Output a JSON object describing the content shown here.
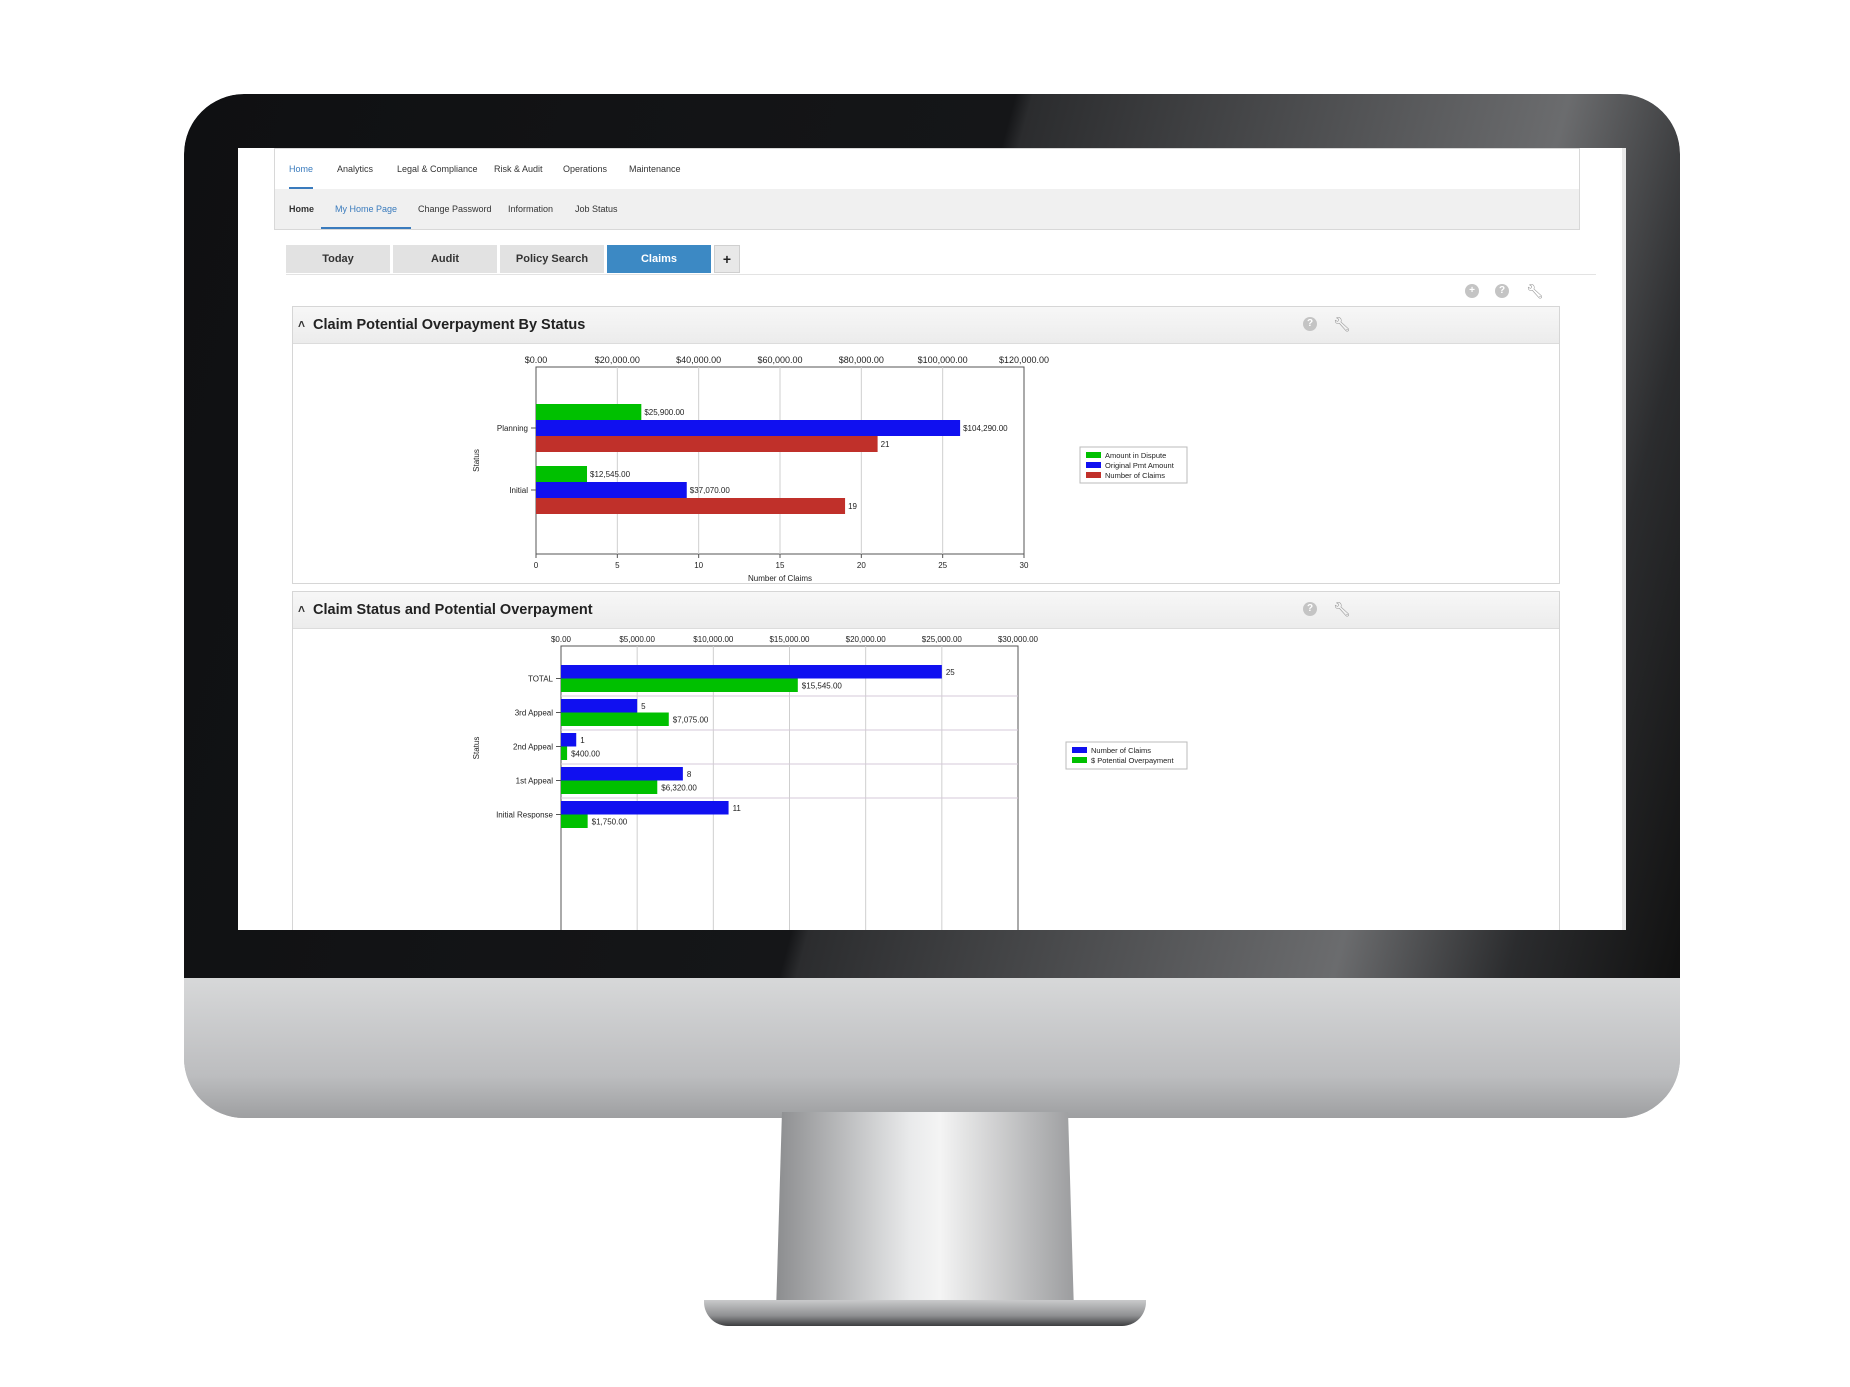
{
  "nav": {
    "top_items": [
      "Home",
      "Analytics",
      "Legal & Compliance",
      "Risk & Audit",
      "Operations",
      "Maintenance"
    ],
    "top_active": 0,
    "sub_items": [
      "Home",
      "My Home Page",
      "Change Password",
      "Information",
      "Job Status"
    ],
    "sub_active": 1
  },
  "tabs": {
    "items": [
      "Today",
      "Audit",
      "Policy Search",
      "Claims"
    ],
    "active": 3,
    "add_label": "+"
  },
  "toolbar_icons": [
    "add-icon",
    "help-icon",
    "wrench-icon"
  ],
  "panels": [
    {
      "title": "Claim Potential Overpayment By Status",
      "icons": [
        "help-icon",
        "wrench-icon"
      ]
    },
    {
      "title": "Claim Status and Potential Overpayment",
      "icons": [
        "help-icon",
        "wrench-icon"
      ]
    }
  ],
  "chart_data": [
    {
      "type": "bar",
      "orientation": "horizontal",
      "categories": [
        "Planning",
        "Initial"
      ],
      "xlabel_bottom": "Number of Claims",
      "ylabel": "Status",
      "top_axis": {
        "ticks": [
          "$0.00",
          "$20,000.00",
          "$40,000.00",
          "$60,000.00",
          "$80,000.00",
          "$100,000.00",
          "$120,000.00"
        ],
        "range": [
          0,
          120000
        ]
      },
      "bottom_axis": {
        "ticks": [
          "0",
          "5",
          "10",
          "15",
          "20",
          "25",
          "30"
        ],
        "range": [
          0,
          30
        ]
      },
      "grid": true,
      "legend_position": "right",
      "series": [
        {
          "name": "Amount in Dispute",
          "color": "#00c000",
          "axis": "top",
          "values": [
            25900,
            12545
          ],
          "labels": [
            "$25,900.00",
            "$12,545.00"
          ]
        },
        {
          "name": "Original Pmt Amount",
          "color": "#1010f0",
          "axis": "top",
          "values": [
            104290,
            37070
          ],
          "labels": [
            "$104,290.00",
            "$37,070.00"
          ]
        },
        {
          "name": "Number of Claims",
          "color": "#c0302a",
          "axis": "bottom",
          "values": [
            21,
            19
          ],
          "labels": [
            "21",
            "19"
          ]
        }
      ]
    },
    {
      "type": "bar",
      "orientation": "horizontal",
      "categories": [
        "TOTAL",
        "3rd Appeal",
        "2nd Appeal",
        "1st Appeal",
        "Initial Response"
      ],
      "ylabel": "Status",
      "top_axis": {
        "ticks": [
          "$0.00",
          "$5,000.00",
          "$10,000.00",
          "$15,000.00",
          "$20,000.00",
          "$25,000.00",
          "$30,000.00"
        ],
        "range": [
          0,
          30000
        ]
      },
      "grid": true,
      "legend_position": "right",
      "series": [
        {
          "name": "Number of Claims",
          "color": "#1010f0",
          "scale": "count_on_dollar_axis",
          "values": [
            25,
            5,
            1,
            8,
            11
          ],
          "labels": [
            "25",
            "5",
            "1",
            "8",
            "11"
          ]
        },
        {
          "name": "$ Potential Overpayment",
          "color": "#00c000",
          "scale": "dollars",
          "values": [
            15545,
            7075,
            400,
            6320,
            1750
          ],
          "labels": [
            "$15,545.00",
            "$7,075.00",
            "$400.00",
            "$6,320.00",
            "$1,750.00"
          ]
        }
      ]
    }
  ]
}
